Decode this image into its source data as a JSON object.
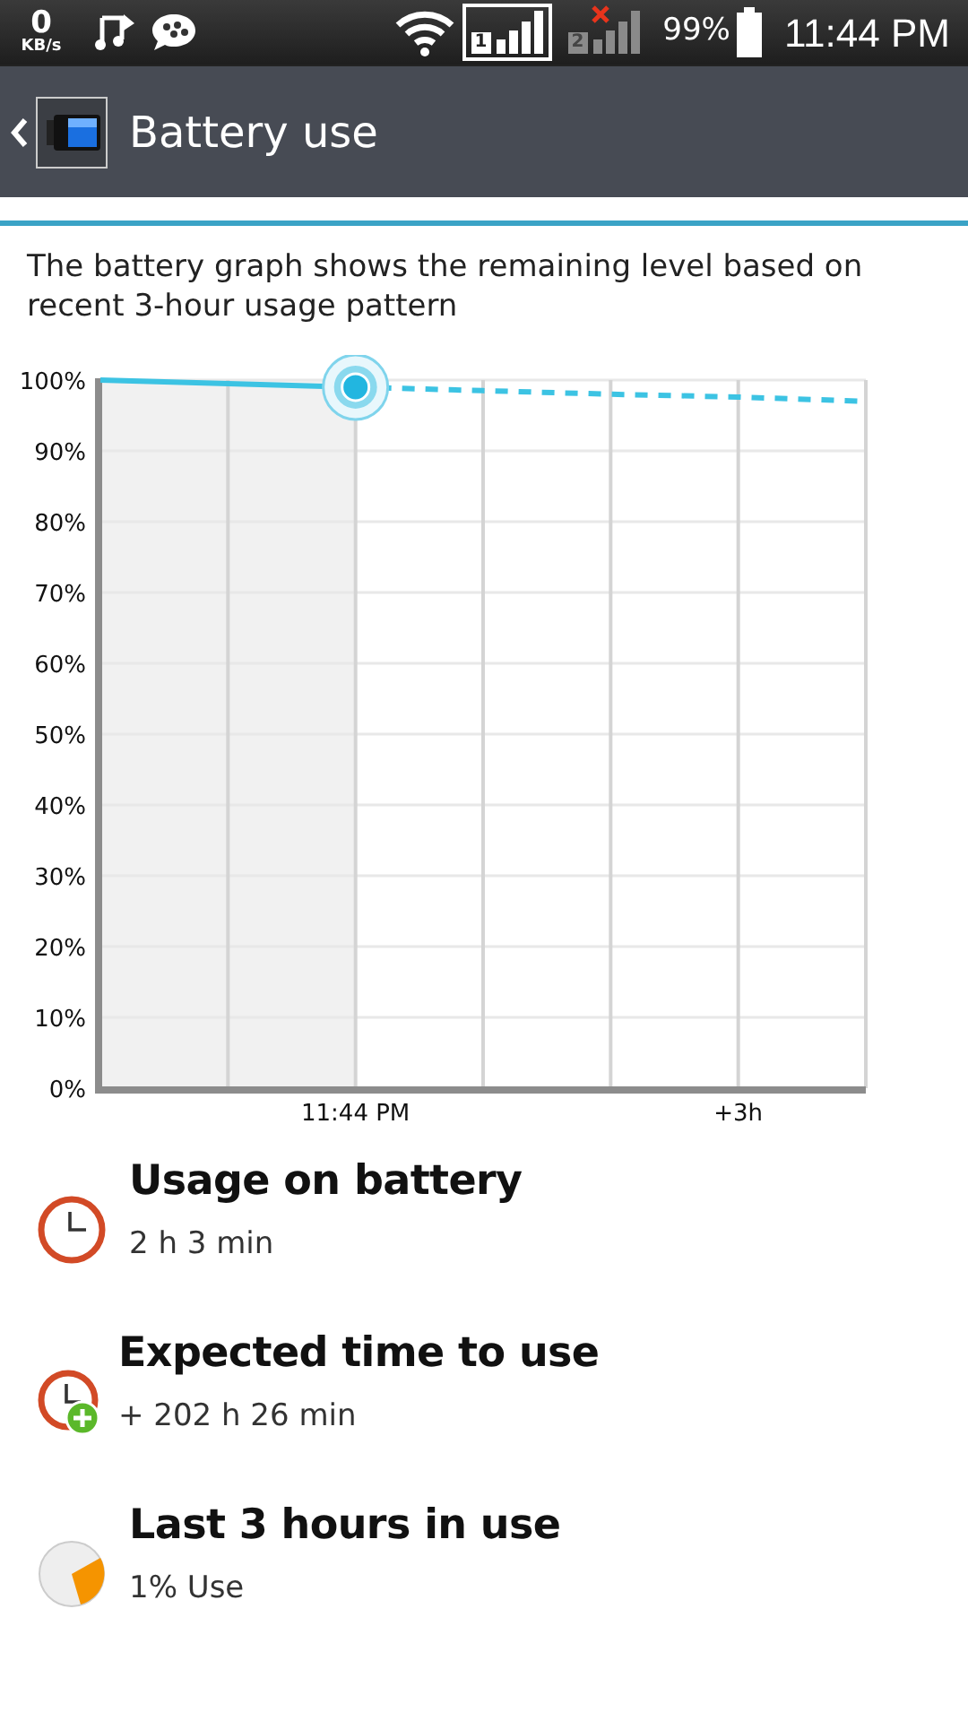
{
  "status_bar": {
    "speed_value": "0",
    "speed_unit": "KB/s",
    "sims": [
      {
        "label": "1",
        "active": true
      },
      {
        "label": "2",
        "active": false
      }
    ],
    "battery_percent": "99%",
    "time": "11:44 PM"
  },
  "header": {
    "title": "Battery use"
  },
  "description": "The battery graph shows the remaining level based on recent 3-hour usage pattern",
  "chart_data": {
    "type": "line",
    "grid": true,
    "categories": [
      null,
      null,
      "11:44 PM",
      null,
      null,
      "+3h",
      null
    ],
    "ylim": [
      0,
      100
    ],
    "yticks": [
      {
        "value": 0,
        "label": "0%"
      },
      {
        "value": 10,
        "label": "10%"
      },
      {
        "value": 20,
        "label": "20%"
      },
      {
        "value": 30,
        "label": "30%"
      },
      {
        "value": 40,
        "label": "40%"
      },
      {
        "value": 50,
        "label": "50%"
      },
      {
        "value": 60,
        "label": "60%"
      },
      {
        "value": 70,
        "label": "70%"
      },
      {
        "value": 80,
        "label": "80%"
      },
      {
        "value": 90,
        "label": "90%"
      },
      {
        "value": 100,
        "label": "100%"
      }
    ],
    "series": [
      {
        "color": "#3cc3e3",
        "line_style": "solid",
        "values": [
          100,
          99.5,
          99,
          null,
          null,
          null,
          null
        ]
      },
      {
        "color": "#3cc3e3",
        "line_style": "dashed",
        "values": [
          null,
          null,
          99,
          98.5,
          98,
          97.6,
          97
        ]
      }
    ]
  },
  "items": [
    {
      "kind": "clock",
      "title": "Usage on battery",
      "value": "2 h 3 min"
    },
    {
      "kind": "clock-plus",
      "title": "Expected time to use",
      "value": "+ 202 h 26 min"
    },
    {
      "kind": "pie",
      "title": "Last 3 hours in use",
      "value": "1% Use"
    }
  ]
}
